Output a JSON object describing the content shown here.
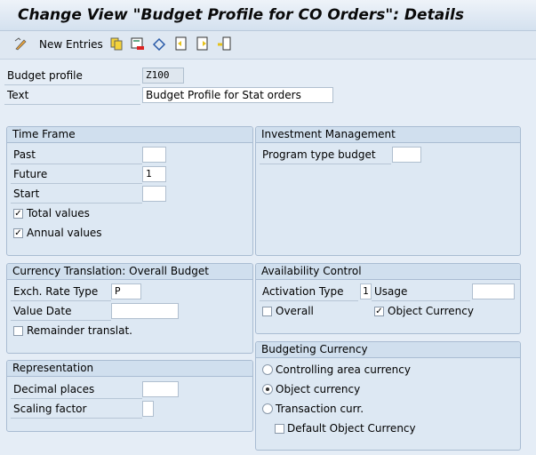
{
  "title": "Change View \"Budget Profile for CO Orders\": Details",
  "toolbar": {
    "new_entries": "New Entries",
    "icons": [
      "edit-icon",
      "copy-icon",
      "delete-icon",
      "undo-icon",
      "previous-entry-icon",
      "next-entry-icon",
      "select-icon"
    ]
  },
  "header": {
    "budget_profile_label": "Budget profile",
    "budget_profile_value": "Z100",
    "text_label": "Text",
    "text_value": "Budget Profile for Stat orders"
  },
  "time_frame": {
    "title": "Time Frame",
    "past_label": "Past",
    "past_value": "",
    "future_label": "Future",
    "future_value": "1",
    "start_label": "Start",
    "start_value": "",
    "total_values": "Total values",
    "total_checked": true,
    "annual_values": "Annual values",
    "annual_checked": true
  },
  "investment": {
    "title": "Investment Management",
    "program_type_label": "Program type budget",
    "program_type_value": ""
  },
  "currency_translation": {
    "title": "Currency Translation: Overall Budget",
    "exch_label": "Exch. Rate Type",
    "exch_value": "P",
    "value_date_label": "Value Date",
    "value_date_value": "",
    "remainder": "Remainder translat.",
    "remainder_checked": false
  },
  "representation": {
    "title": "Representation",
    "decimal_label": "Decimal places",
    "decimal_value": "",
    "scaling_label": "Scaling factor",
    "scaling_value": ""
  },
  "availability": {
    "title": "Availability Control",
    "activation_label": "Activation Type",
    "activation_value": "1",
    "usage_label": "Usage",
    "usage_value": "",
    "overall": "Overall",
    "overall_checked": false,
    "object_currency": "Object Currency",
    "object_currency_checked": true
  },
  "budgeting_currency": {
    "title": "Budgeting Currency",
    "options": [
      "Controlling area currency",
      "Object currency",
      "Transaction curr."
    ],
    "selected": "Object currency",
    "default_object": "Default Object Currency",
    "default_checked": false
  }
}
